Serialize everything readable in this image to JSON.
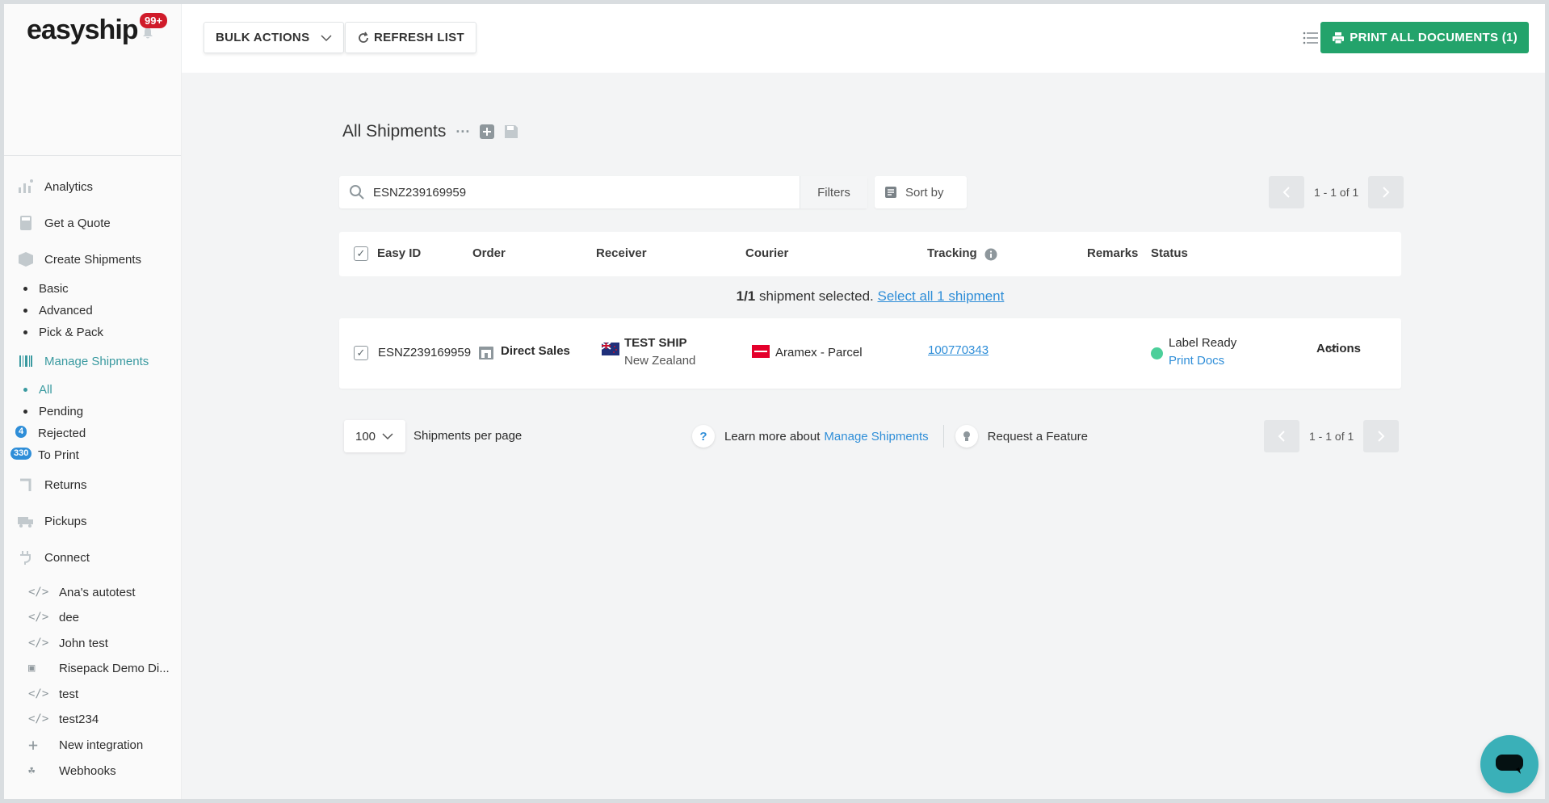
{
  "sidebar": {
    "logo": "easyship",
    "notification_badge": "99+",
    "nav": {
      "analytics": "Analytics",
      "quote": "Get a Quote",
      "create": "Create Shipments",
      "create_sub": [
        "Basic",
        "Advanced",
        "Pick & Pack"
      ],
      "manage": "Manage Shipments",
      "manage_sub": {
        "all": "All",
        "pending": "Pending",
        "rejected": "Rejected",
        "rejected_count": "4",
        "to_print": "To Print",
        "to_print_count": "330"
      },
      "returns": "Returns",
      "pickups": "Pickups",
      "connect": "Connect"
    },
    "integrations": [
      "Ana's autotest",
      "dee",
      "John test",
      "Risepack Demo Di...",
      "test",
      "test234",
      "New integration",
      "Webhooks"
    ]
  },
  "toolbar": {
    "bulk_actions": "BULK ACTIONS",
    "refresh": "REFRESH LIST",
    "print_all": "PRINT ALL DOCUMENTS (1)"
  },
  "page": {
    "title": "All Shipments",
    "search_value": "ESNZ239169959",
    "filters": "Filters",
    "sort_by": "Sort by",
    "pager_text": "1 - 1 of 1"
  },
  "table": {
    "headers": {
      "easy_id": "Easy ID",
      "order": "Order",
      "receiver": "Receiver",
      "courier": "Courier",
      "tracking": "Tracking",
      "remarks": "Remarks",
      "status": "Status"
    },
    "selection": {
      "count": "1/1",
      "text": "shipment selected.",
      "select_all": "Select all 1 shipment"
    },
    "rows": [
      {
        "easy_id": "ESNZ239169959",
        "order": "Direct Sales",
        "receiver_name": "TEST SHIP",
        "receiver_country": "New Zealand",
        "courier": "Aramex - Parcel",
        "tracking": "100770343",
        "status": "Label Ready",
        "status_action": "Print Docs",
        "actions": "Actions"
      }
    ]
  },
  "footer": {
    "per_page_value": "100",
    "per_page_label": "Shipments per page",
    "learn_prefix": "Learn more about",
    "learn_link": "Manage Shipments",
    "request_feature": "Request a Feature",
    "pager_text": "1 - 1 of 1"
  },
  "colors": {
    "accent": "#3a9aa0",
    "primary_button": "#23a36b",
    "link": "#2f8ed8",
    "status_ready": "#4bcf9a",
    "badge_red": "#d01b2a"
  }
}
